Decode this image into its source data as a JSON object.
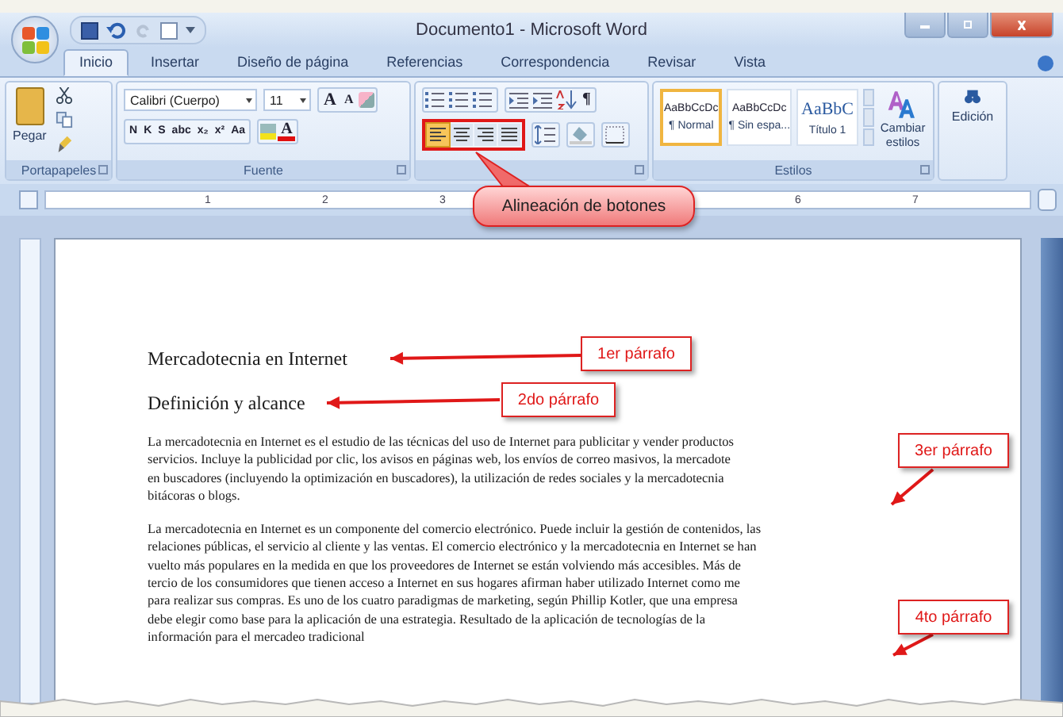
{
  "window": {
    "title": "Documento1 - Microsoft Word"
  },
  "tabs": [
    {
      "label": "Inicio",
      "selected": true
    },
    {
      "label": "Insertar",
      "selected": false
    },
    {
      "label": "Diseño de página",
      "selected": false
    },
    {
      "label": "Referencias",
      "selected": false
    },
    {
      "label": "Correspondencia",
      "selected": false
    },
    {
      "label": "Revisar",
      "selected": false
    },
    {
      "label": "Vista",
      "selected": false
    }
  ],
  "ribbon": {
    "clipboard": {
      "paste_label": "Pegar",
      "group_label": "Portapapeles"
    },
    "font": {
      "font_name": "Calibri (Cuerpo)",
      "font_size": "11",
      "grow_buttons": [
        "A",
        "A"
      ],
      "format_buttons": [
        "N",
        "K",
        "S",
        "abc",
        "x₂",
        "x²",
        "Aa"
      ],
      "font_color_button": "A",
      "group_label": "Fuente"
    },
    "paragraph": {
      "alignment_buttons": [
        {
          "selected": true
        },
        {
          "selected": false
        },
        {
          "selected": false
        },
        {
          "selected": false
        }
      ],
      "pilcrow": "¶"
    },
    "styles": {
      "items": [
        {
          "sample": "AaBbCcDc",
          "label": "¶ Normal",
          "selected": true
        },
        {
          "sample": "AaBbCcDc",
          "label": "¶ Sin espa...",
          "selected": false
        },
        {
          "sample": "AaBbC",
          "label": "Título 1",
          "selected": false
        }
      ],
      "change_styles": "Cambiar estilos",
      "group_label": "Estilos"
    },
    "editing": {
      "label": "Edición"
    }
  },
  "ruler": {
    "left_ticks": [
      "1",
      "2",
      "3"
    ],
    "right_ticks": [
      "6",
      "7"
    ]
  },
  "document": {
    "heading": "Mercadotecnia en Internet",
    "subheading": "Definición y alcance",
    "paragraphs": [
      [
        "La mercadotecnia en Internet es el estudio de las técnicas del uso de Internet para publicitar y vender productos",
        "servicios. Incluye la publicidad por clic, los avisos en páginas web, los envíos de correo masivos, la mercadote",
        "en buscadores (incluyendo la optimización en buscadores), la utilización de redes sociales y la mercadotecnia",
        "bitácoras o blogs."
      ],
      [
        "La mercadotecnia en Internet es un componente del comercio electrónico. Puede incluir la gestión de contenidos, las",
        "relaciones públicas, el servicio al cliente y las ventas. El comercio electrónico y la mercadotecnia en Internet se han",
        "vuelto más populares en la medida en que los proveedores de Internet se están volviendo más accesibles. Más de",
        "tercio de los consumidores que tienen acceso a Internet en sus hogares afirman haber utilizado Internet como me",
        "para realizar sus compras. Es uno de los cuatro paradigmas de marketing, según Phillip Kotler, que una empresa",
        "debe elegir como base para la aplicación de una estrategia. Resultado de la aplicación de tecnologías de la",
        "información para el mercadeo tradicional"
      ]
    ]
  },
  "callouts": [
    {
      "kind": "pill",
      "text": "Alineación de botones"
    },
    {
      "kind": "box",
      "text": "1er párrafo"
    },
    {
      "kind": "box",
      "text": "2do párrafo"
    },
    {
      "kind": "box",
      "text": "3er párrafo"
    },
    {
      "kind": "box",
      "text": "4to párrafo"
    }
  ]
}
